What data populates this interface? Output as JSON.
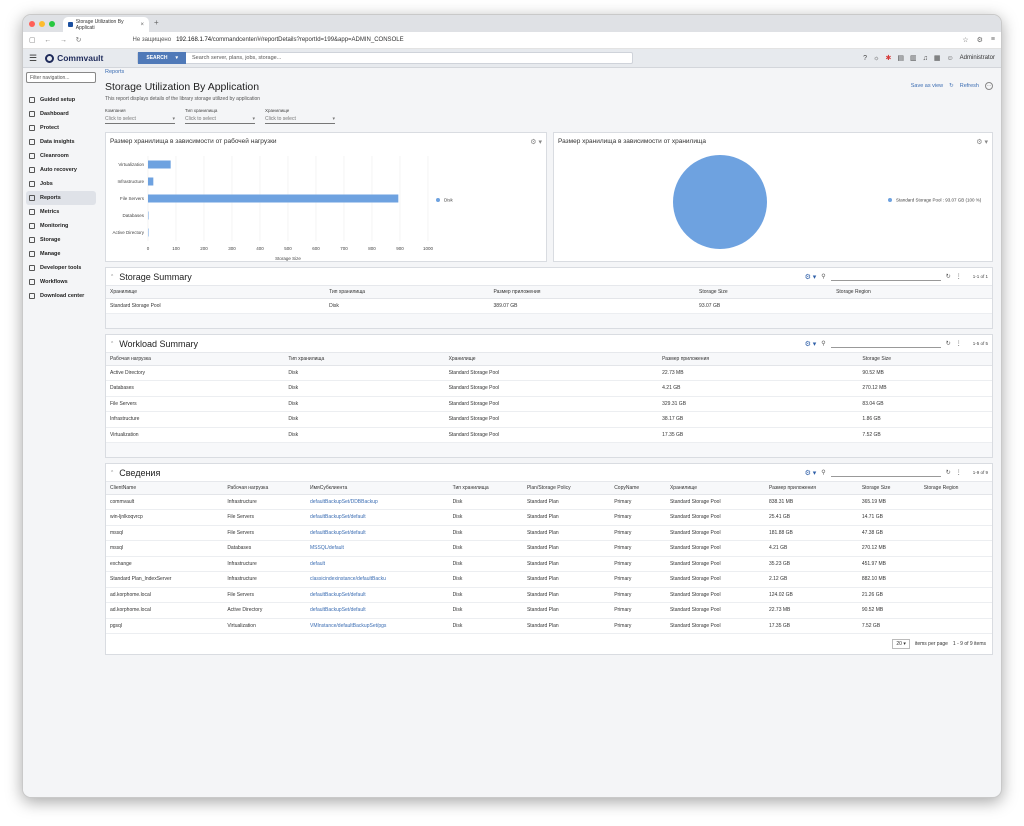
{
  "browser": {
    "tab_title": "Storage Utilization By Applicati",
    "url_warning": "Не защищено",
    "url_host": "192.168.1.74",
    "url_path": "/commandcenter/#/reportDetails?reportId=199&app=ADMIN_CONSOLE"
  },
  "header": {
    "brand": "Commvault",
    "search_button": "SEARCH",
    "search_placeholder": "Search server, plans, jobs, storage...",
    "user": "Administrator"
  },
  "sidebar": {
    "filter_placeholder": "Filter navigation...",
    "items": [
      {
        "label": "Guided setup"
      },
      {
        "label": "Dashboard"
      },
      {
        "label": "Protect"
      },
      {
        "label": "Data insights"
      },
      {
        "label": "Cleanroom"
      },
      {
        "label": "Auto recovery"
      },
      {
        "label": "Jobs"
      },
      {
        "label": "Reports",
        "active": true
      },
      {
        "label": "Metrics"
      },
      {
        "label": "Monitoring"
      },
      {
        "label": "Storage"
      },
      {
        "label": "Manage"
      },
      {
        "label": "Developer tools"
      },
      {
        "label": "Workflows"
      },
      {
        "label": "Download center"
      }
    ]
  },
  "page": {
    "breadcrumb": "Reports",
    "title": "Storage Utilization By Application",
    "description": "This report displays details of the library storage utilized by application",
    "save_as_view": "Save as view",
    "refresh": "Refresh",
    "filters": [
      {
        "label": "Компания",
        "value": "Click to select"
      },
      {
        "label": "Тип хранилища",
        "value": "Click to select"
      },
      {
        "label": "Хранилище",
        "value": "Click to select"
      }
    ]
  },
  "chart_data": [
    {
      "type": "bar",
      "title": "Размер хранилища в зависимости от рабочей нагрузки",
      "categories": [
        "Virtualization",
        "Infrastructure",
        "File Servers",
        "Databases",
        "Active Directory"
      ],
      "series": [
        {
          "name": "Disk",
          "values": [
            81,
            19,
            894,
            0.2,
            0.1
          ],
          "color": "#6ea2e0"
        }
      ],
      "xlabel": "Storage Size",
      "xlim": [
        0,
        1000
      ],
      "xticks": [
        0,
        100,
        200,
        300,
        400,
        500,
        600,
        700,
        800,
        900,
        1000
      ],
      "legend": "right"
    },
    {
      "type": "pie",
      "title": "Размер хранилища в зависимости от хранилища",
      "slices": [
        {
          "label": "Standard Storage Pool : 93.07 GB (100 %)",
          "value": 100,
          "color": "#6ea2e0"
        }
      ],
      "legend": "right"
    }
  ],
  "storage_summary": {
    "title": "Storage Summary",
    "count": "1-1 of 1",
    "columns": [
      "Хранилище",
      "Тип хранилища",
      "Размер приложения",
      "Storage Size",
      "Storage Region"
    ],
    "rows": [
      [
        "Standard Storage Pool",
        "Disk",
        "389.07 GB",
        "93.07 GB",
        ""
      ]
    ]
  },
  "workload_summary": {
    "title": "Workload Summary",
    "count": "1-5 of 5",
    "columns": [
      "Рабочая нагрузка",
      "Тип хранилища",
      "Хранилище",
      "Размер приложения",
      "Storage Size"
    ],
    "rows": [
      [
        "Active Directory",
        "Disk",
        "Standard Storage Pool",
        "22.73 MB",
        "90.52 MB"
      ],
      [
        "Databases",
        "Disk",
        "Standard Storage Pool",
        "4.21 GB",
        "270.12 MB"
      ],
      [
        "File Servers",
        "Disk",
        "Standard Storage Pool",
        "329.31 GB",
        "83.04 GB"
      ],
      [
        "Infrastructure",
        "Disk",
        "Standard Storage Pool",
        "38.17 GB",
        "1.86 GB"
      ],
      [
        "Virtualization",
        "Disk",
        "Standard Storage Pool",
        "17.35 GB",
        "7.52 GB"
      ]
    ]
  },
  "details": {
    "title": "Сведения",
    "count": "1-9 of 9",
    "columns": [
      "ClientName",
      "Рабочая нагрузка",
      "ИмяСубклиента",
      "Тип хранилища",
      "Plan/Storage Policy",
      "CopyName",
      "Хранилище",
      "Размер приложения",
      "Storage Size",
      "Storage Region"
    ],
    "rows": [
      [
        "commvault",
        "Infrastructure",
        "defaultBackupSet/DDBBackup",
        "Disk",
        "Standard Plan",
        "Primary",
        "Standard Storage Pool",
        "838.31 MB",
        "365.19 MB",
        ""
      ],
      [
        "win-ljnlkoqvrcp",
        "File Servers",
        "defaultBackupSet/default",
        "Disk",
        "Standard Plan",
        "Primary",
        "Standard Storage Pool",
        "25.41 GB",
        "14.71 GB",
        ""
      ],
      [
        "mssql",
        "File Servers",
        "defaultBackupSet/default",
        "Disk",
        "Standard Plan",
        "Primary",
        "Standard Storage Pool",
        "181.88 GB",
        "47.38 GB",
        ""
      ],
      [
        "mssql",
        "Databases",
        "MSSQL/default",
        "Disk",
        "Standard Plan",
        "Primary",
        "Standard Storage Pool",
        "4.21 GB",
        "270.12 MB",
        ""
      ],
      [
        "exchange",
        "Infrastructure",
        "default",
        "Disk",
        "Standard Plan",
        "Primary",
        "Standard Storage Pool",
        "35.23 GB",
        "451.97 MB",
        ""
      ],
      [
        "Standard Plan_IndexServer",
        "Infrastructure",
        "classicindexinstance/defaultBacku",
        "Disk",
        "Standard Plan",
        "Primary",
        "Standard Storage Pool",
        "2.12 GB",
        "882.10 MB",
        ""
      ],
      [
        "ad.korphome.local",
        "File Servers",
        "defaultBackupSet/default",
        "Disk",
        "Standard Plan",
        "Primary",
        "Standard Storage Pool",
        "124.02 GB",
        "21.26 GB",
        ""
      ],
      [
        "ad.korphome.local",
        "Active Directory",
        "defaultBackupSet/default",
        "Disk",
        "Standard Plan",
        "Primary",
        "Standard Storage Pool",
        "22.73 MB",
        "90.52 MB",
        ""
      ],
      [
        "pgsql",
        "Virtualization",
        "VMInstance/defaultBackupSet/pgs",
        "Disk",
        "Standard Plan",
        "Primary",
        "Standard Storage Pool",
        "17.35 GB",
        "7.52 GB",
        ""
      ]
    ],
    "page_size": "20",
    "items_per_page": "items per page",
    "range": "1 - 9 of 9 items"
  }
}
